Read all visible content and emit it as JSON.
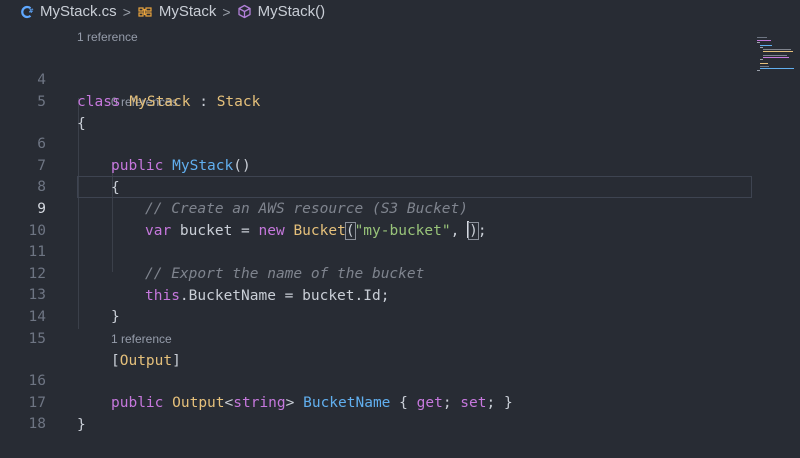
{
  "breadcrumb": {
    "file": "MyStack.cs",
    "class": "MyStack",
    "method": "MyStack()",
    "separator": ">"
  },
  "editor": {
    "active_line": "9",
    "lenses": {
      "class_refs": "1 reference",
      "ctor_refs": "0 references",
      "prop_refs": "1 reference"
    },
    "lines": [
      {
        "number": "4",
        "tokens": [
          "class",
          " ",
          "MyStack",
          " : ",
          "Stack"
        ]
      },
      {
        "number": "5",
        "tokens": [
          "{"
        ]
      },
      {
        "number": "6",
        "tokens": [
          "public",
          " ",
          "MyStack",
          "()"
        ]
      },
      {
        "number": "7",
        "tokens": [
          "{"
        ]
      },
      {
        "number": "8",
        "tokens": [
          "// Create an AWS resource (S3 Bucket)"
        ]
      },
      {
        "number": "9",
        "tokens": [
          "var",
          " bucket = ",
          "new",
          " ",
          "Bucket",
          "(",
          "\"my-bucket\"",
          ", ",
          ")",
          ";"
        ]
      },
      {
        "number": "10",
        "tokens": []
      },
      {
        "number": "11",
        "tokens": [
          "// Export the name of the bucket"
        ]
      },
      {
        "number": "12",
        "tokens": [
          "this",
          ".BucketName = bucket.Id;"
        ]
      },
      {
        "number": "13",
        "tokens": [
          "}"
        ]
      },
      {
        "number": "14",
        "tokens": []
      },
      {
        "number": "15",
        "tokens": [
          "[",
          "Output",
          "]"
        ]
      },
      {
        "number": "16",
        "tokens": [
          "public",
          " ",
          "Output",
          "<",
          "string",
          "> ",
          "BucketName",
          " { ",
          "get",
          "; ",
          "set",
          "; }"
        ]
      },
      {
        "number": "17",
        "tokens": [
          "}"
        ]
      },
      {
        "number": "18",
        "tokens": []
      }
    ]
  },
  "colors": {
    "background": "#282c34",
    "keyword": "#c678dd",
    "type": "#e5c07b",
    "function": "#61afef",
    "string": "#98c379",
    "comment": "#7f848e"
  },
  "icons": [
    "csharp-file-icon",
    "class-icon",
    "method-cube-icon"
  ]
}
